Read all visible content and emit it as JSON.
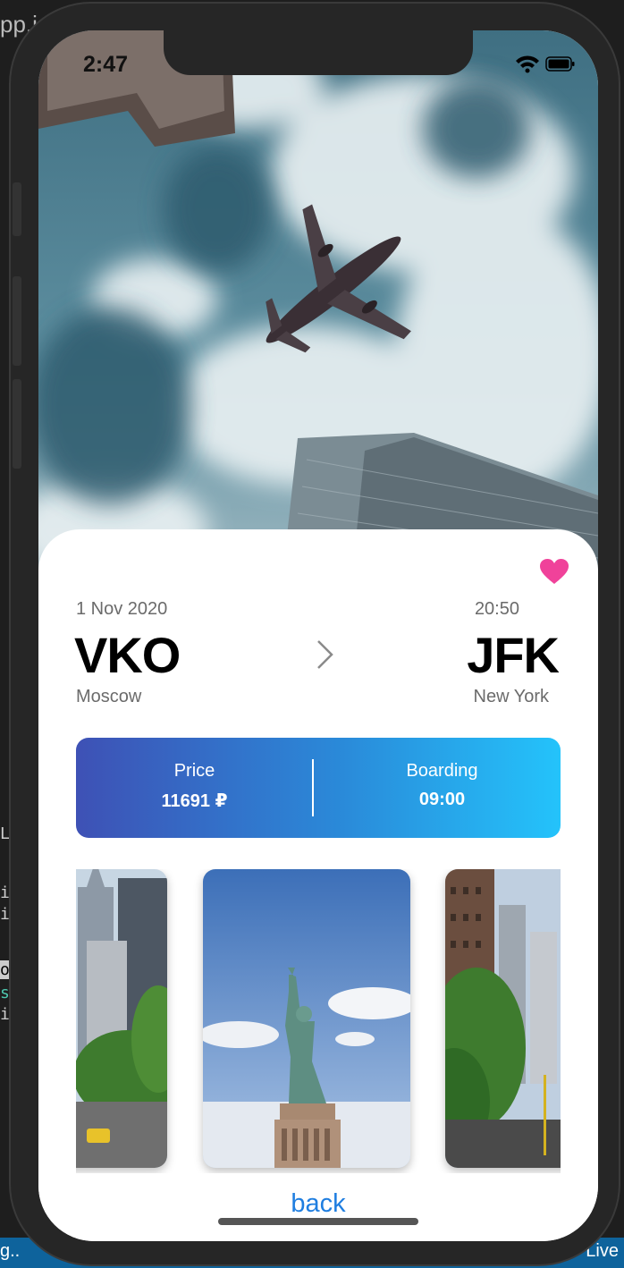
{
  "editor": {
    "tab_fragment": "pp.js",
    "left_letters": [
      "L",
      "i",
      "i",
      "o",
      "s",
      "i"
    ],
    "status_left": "g..",
    "status_right": "Live"
  },
  "status_bar": {
    "time": "2:47"
  },
  "flight": {
    "date": "1 Nov 2020",
    "time": "20:50",
    "from_code": "VKO",
    "to_code": "JFK",
    "from_city": "Moscow",
    "to_city": "New York"
  },
  "info": {
    "price_label": "Price",
    "price_value": "11691 ₽",
    "boarding_label": "Boarding",
    "boarding_value": "09:00"
  },
  "back_label": "back",
  "colors": {
    "heart": "#f0429a",
    "gradient_start": "#3e51b5",
    "gradient_end": "#24c3fb",
    "link": "#1f7ee0"
  },
  "icons": [
    "heart-icon",
    "chevron-right-icon",
    "wifi-icon",
    "battery-icon"
  ]
}
